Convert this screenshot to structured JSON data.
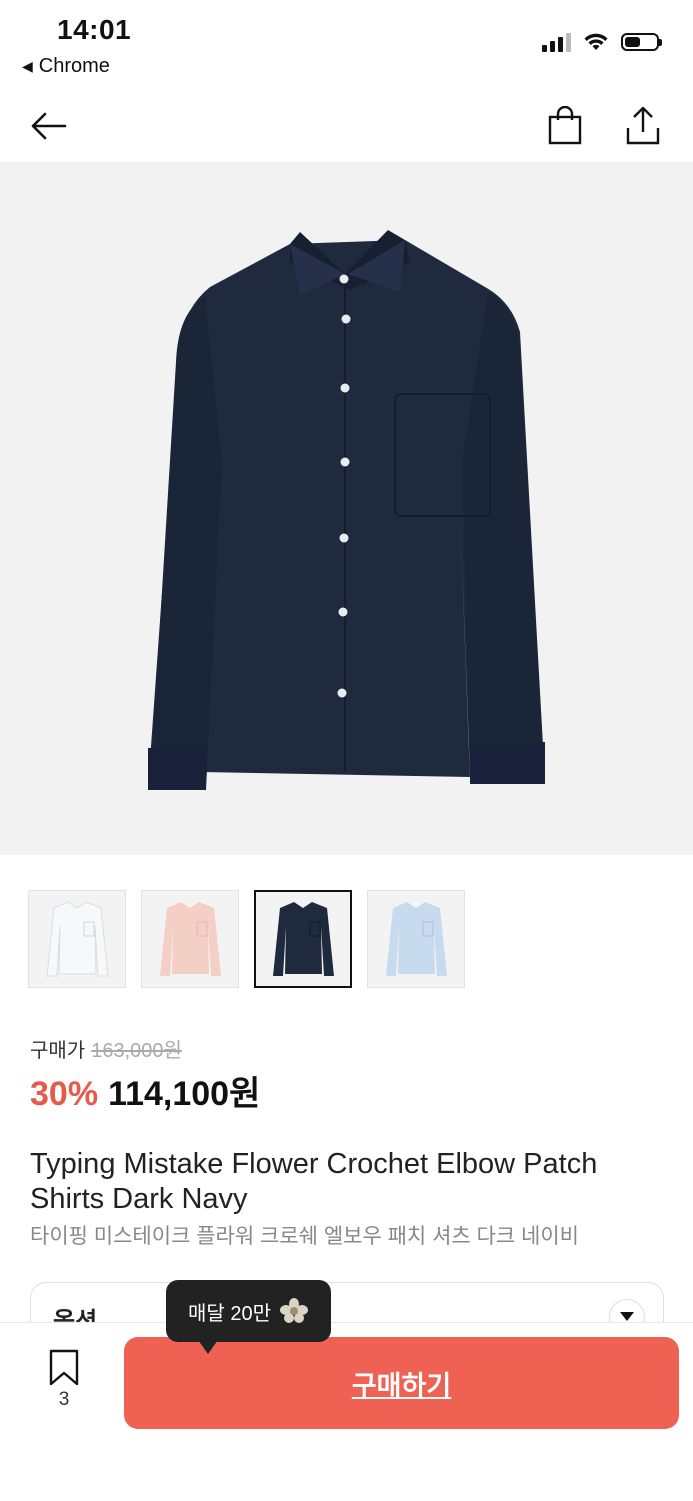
{
  "status_bar": {
    "time": "14:01",
    "back_app": "Chrome",
    "battery_level": 0.5
  },
  "nav": {
    "back_icon": "back-arrow-icon",
    "cart_icon": "shopping-bag-icon",
    "share_icon": "share-icon"
  },
  "product": {
    "image_alt_color": "#1f2a3f",
    "thumbnails": [
      {
        "color": "#f7f8fa",
        "label": "white"
      },
      {
        "color": "#f4cfc6",
        "label": "pink"
      },
      {
        "color": "#1f2a3f",
        "label": "navy"
      },
      {
        "color": "#c8dbee",
        "label": "light blue"
      }
    ],
    "selected_thumbnail": 2,
    "price_label": "구매가",
    "original_price": "163,000원",
    "discount": "30%",
    "sale_price": "114,100원",
    "title_en": "Typing Mistake Flower Crochet Elbow Patch Shirts Dark Navy",
    "title_ko": "타이핑 미스테이크 플라워 크로쉐 엘보우 패치 셔츠 다크 네이비",
    "option_label": "옵션"
  },
  "tooltip": {
    "text": "매달 20만",
    "icon": "flower-coin-icon"
  },
  "bottom": {
    "bookmark_count": "3",
    "buy_label": "구매하기"
  },
  "colors": {
    "accent": "#ef6253",
    "discount": "#e55a4a"
  }
}
